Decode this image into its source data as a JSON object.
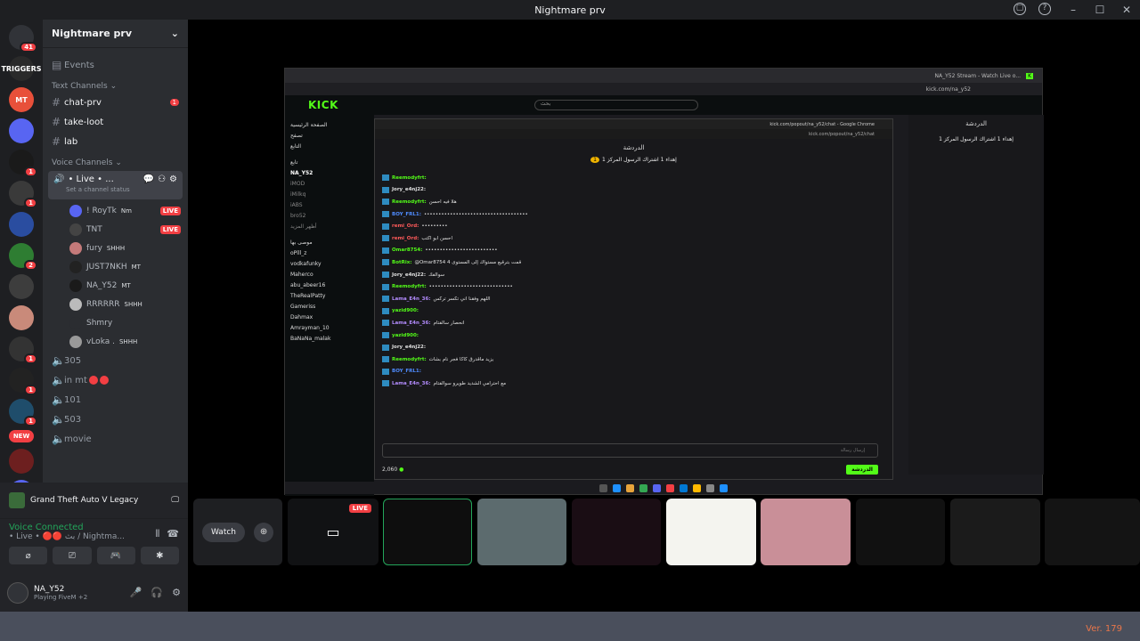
{
  "window": {
    "title": "Nightmare prv"
  },
  "guilds": [
    {
      "name": "home-discord-icon",
      "badge": "41",
      "color": "#313338"
    },
    {
      "name": "triggers-server",
      "label": "TRIGGERS",
      "color": "#2a2a2a"
    },
    {
      "name": "server-mt",
      "label": "MT",
      "color": "#e8503a"
    },
    {
      "name": "server-blue",
      "label": "",
      "color": "#5865f2"
    },
    {
      "name": "server-4",
      "label": "",
      "color": "#1a1a1a",
      "badge": "1"
    },
    {
      "name": "server-5",
      "label": "",
      "color": "#3a3a3a",
      "badge": "1"
    },
    {
      "name": "server-6",
      "label": "",
      "color": "#2a4da0"
    },
    {
      "name": "server-7",
      "label": "",
      "color": "#2e7d32",
      "badge": "2"
    },
    {
      "name": "server-8",
      "label": "",
      "color": "#3d3d3d"
    },
    {
      "name": "server-9",
      "label": "",
      "color": "#c98a7a"
    },
    {
      "name": "server-10",
      "label": "",
      "color": "#333",
      "badge": "1"
    },
    {
      "name": "server-11",
      "label": "",
      "color": "#222",
      "badge": "1"
    },
    {
      "name": "server-12",
      "label": "",
      "color": "#1f4d6b",
      "badge": "1"
    },
    {
      "name": "server-13",
      "label": "",
      "color": "#6d1f1f"
    },
    {
      "name": "server-14",
      "label": "",
      "color": "#5865f2"
    }
  ],
  "guilds_new_badge": "NEW",
  "sidebar": {
    "server_name": "Nightmare prv",
    "events": "Events",
    "text_category": "Text Channels",
    "text_channels": [
      {
        "name": "chat-prv",
        "badge": "1"
      },
      {
        "name": "take-loot"
      },
      {
        "name": "lab"
      }
    ],
    "voice_category": "Voice Channels",
    "live_channel": {
      "name": "• Live • ...",
      "status": "Set a channel status"
    },
    "members": [
      {
        "name": "! RoyTk",
        "tag": "Nm",
        "live": "LIVE"
      },
      {
        "name": "TNT",
        "tag": "",
        "live": "LIVE"
      },
      {
        "name": "fury",
        "tag": "SHHH"
      },
      {
        "name": "JUST7NKH",
        "tag": "MT"
      },
      {
        "name": "NA_Y52",
        "tag": "MT"
      },
      {
        "name": "RRRRRR",
        "tag": "SHHH"
      },
      {
        "name": "Shmry",
        "tag": ""
      },
      {
        "name": "vLoka .",
        "tag": "SHHH"
      }
    ],
    "voice_channels": [
      {
        "name": "305"
      },
      {
        "name": "in mt"
      },
      {
        "name": "101"
      },
      {
        "name": "503"
      },
      {
        "name": "movie"
      }
    ]
  },
  "game_activity": "Grand Theft Auto V Legacy",
  "voice": {
    "status": "Voice Connected",
    "channel": "• Live • 🔴🔴 بث / Nightma..."
  },
  "user": {
    "name": "NA_Y52",
    "status": "Playing FiveM +2"
  },
  "stream": {
    "kick_logo": "KICK",
    "search_placeholder": "بحث",
    "tab_title": "NA_Y52 Stream - Watch Live o...",
    "url": "kick.com/na_y52",
    "popup_title": "kick.com/popout/na_y52/chat - Google Chrome",
    "popup_url": "kick.com/popout/na_y52/chat",
    "chat_title": "الدردشة",
    "pinned": "إهداء 1 اشتراك الرسول المركز 1",
    "side_items": [
      "الصفحة الرئيسية",
      "تصفح",
      "التابع",
      "تابع",
      "NA_Y52",
      "iMOD",
      "iMilkq",
      "iABS",
      "bro52",
      "أظهر المزيد",
      "موصى بها",
      "oPlll_z",
      "vodkafunky",
      "Maherco",
      "abu_abeer16",
      "TheRealPatty",
      "Gameriss",
      "Dahmax",
      "Amrayman_10",
      "BaNaNa_malak"
    ],
    "messages": [
      {
        "user": "Reemodyfrt:",
        "text": "",
        "color": "#53fc18"
      },
      {
        "user": "Jory_e4nj22:",
        "text": "",
        "color": "#e0e0e0"
      },
      {
        "user": "Reemodyfrt:",
        "text": "هلا فيه احسن",
        "color": "#53fc18"
      },
      {
        "user": "BOY_FRL1:",
        "text": "••••••••••••••••••••••••••••••••••••",
        "color": "#4f8cff"
      },
      {
        "user": "remi_Ord:",
        "text": "•••••••••",
        "color": "#ff5a5a"
      },
      {
        "user": "remi_Ord:",
        "text": "احسن ابو اكتب",
        "color": "#ff5a5a"
      },
      {
        "user": "Omar8754:",
        "text": "•••••••••••••••••••••••••",
        "color": "#53fc18"
      },
      {
        "user": "BotRix:",
        "text": "@Omar8754 قمت بترقيع مستواك إلى المستوى 4",
        "color": "#53fc18"
      },
      {
        "user": "Jory_e4nj22:",
        "text": "سوالفك",
        "color": "#e0e0e0"
      },
      {
        "user": "Reemodyfrt:",
        "text": "•••••••••••••••••••••••••••••",
        "color": "#53fc18"
      },
      {
        "user": "Lama_E4n_36:",
        "text": "اللهم وفقنا اني تكسر تركس",
        "color": "#b48cff"
      },
      {
        "user": "yazid900:",
        "text": "",
        "color": "#53fc18"
      },
      {
        "user": "Lama_E4n_36:",
        "text": "انحصار سالفتام",
        "color": "#b48cff"
      },
      {
        "user": "yazid900:",
        "text": "",
        "color": "#53fc18"
      },
      {
        "user": "Jory_e4nj22:",
        "text": "",
        "color": "#e0e0e0"
      },
      {
        "user": "Reemodyfrt:",
        "text": "يزيد ماقدرق كاكا فجر نام بشات",
        "color": "#53fc18"
      },
      {
        "user": "BOY_FRL1:",
        "text": "",
        "color": "#4f8cff"
      },
      {
        "user": "Lama_E4n_36:",
        "text": "مع احترامي الشديد طويرو سوالفتام",
        "color": "#b48cff"
      }
    ],
    "input_placeholder": "إرسال رسالة",
    "points": "2,060",
    "chat_button": "الدردشة"
  },
  "strip": {
    "watch": "Watch",
    "live": "LIVE"
  },
  "version": "Ver. 179"
}
